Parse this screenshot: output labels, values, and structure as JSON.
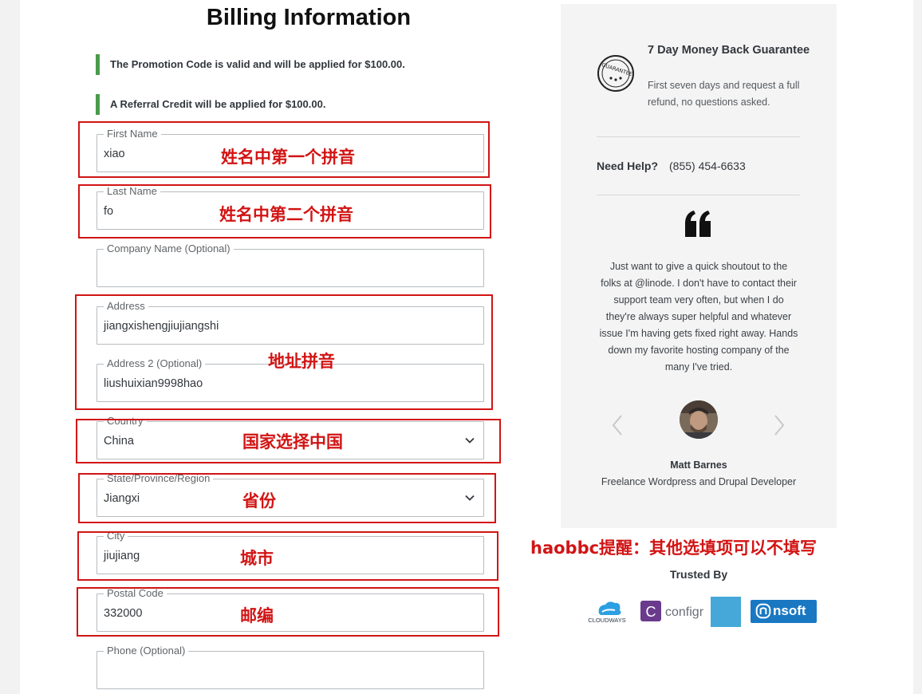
{
  "title": "Billing Information",
  "notices": [
    "The Promotion Code is valid and will be applied for $100.00.",
    "A Referral Credit will be applied for $100.00."
  ],
  "fields": {
    "first_name": {
      "label": "First Name",
      "value": "xiao"
    },
    "last_name": {
      "label": "Last Name",
      "value": "fo"
    },
    "company": {
      "label": "Company Name (Optional)",
      "value": ""
    },
    "address": {
      "label": "Address",
      "value": "jiangxishengjiujiangshi"
    },
    "address2": {
      "label": "Address 2 (Optional)",
      "value": "liushuixian9998hao"
    },
    "country": {
      "label": "Country",
      "value": "China"
    },
    "state": {
      "label": "State/Province/Region",
      "value": "Jiangxi"
    },
    "city": {
      "label": "City",
      "value": "jiujiang"
    },
    "postal": {
      "label": "Postal Code",
      "value": "332000"
    },
    "phone": {
      "label": "Phone (Optional)",
      "value": ""
    }
  },
  "annotations": {
    "first_name": "姓名中第一个拼音",
    "last_name": "姓名中第二个拼音",
    "address": "地址拼音",
    "country": "国家选择中国",
    "state": "省份",
    "city": "城市",
    "postal": "邮编",
    "reminder": "haobbc提醒：其他选填项可以不填写"
  },
  "sidebar": {
    "guarantee_title": "7 Day Money Back Guarantee",
    "guarantee_desc": "First seven days and request a full refund, no questions asked.",
    "help_label": "Need Help?",
    "help_phone": "(855) 454-6633",
    "testimonial": "Just want to give a quick shoutout to the folks at @linode. I don't have to contact their support team very often, but when I do they're always super helpful and whatever issue I'm having gets fixed right away. Hands down my favorite hosting company of the many I've tried.",
    "author_name": "Matt Barnes",
    "author_role": "Freelance Wordpress and Drupal Developer"
  },
  "trusted_by": {
    "heading": "Trusted By",
    "logos": [
      "CLOUDWAYS",
      "configr",
      "nsoft"
    ]
  },
  "colors": {
    "accent_green": "#4b9a4b",
    "annotation_red": "#d21414",
    "nsoft_blue": "#1a78c2"
  }
}
